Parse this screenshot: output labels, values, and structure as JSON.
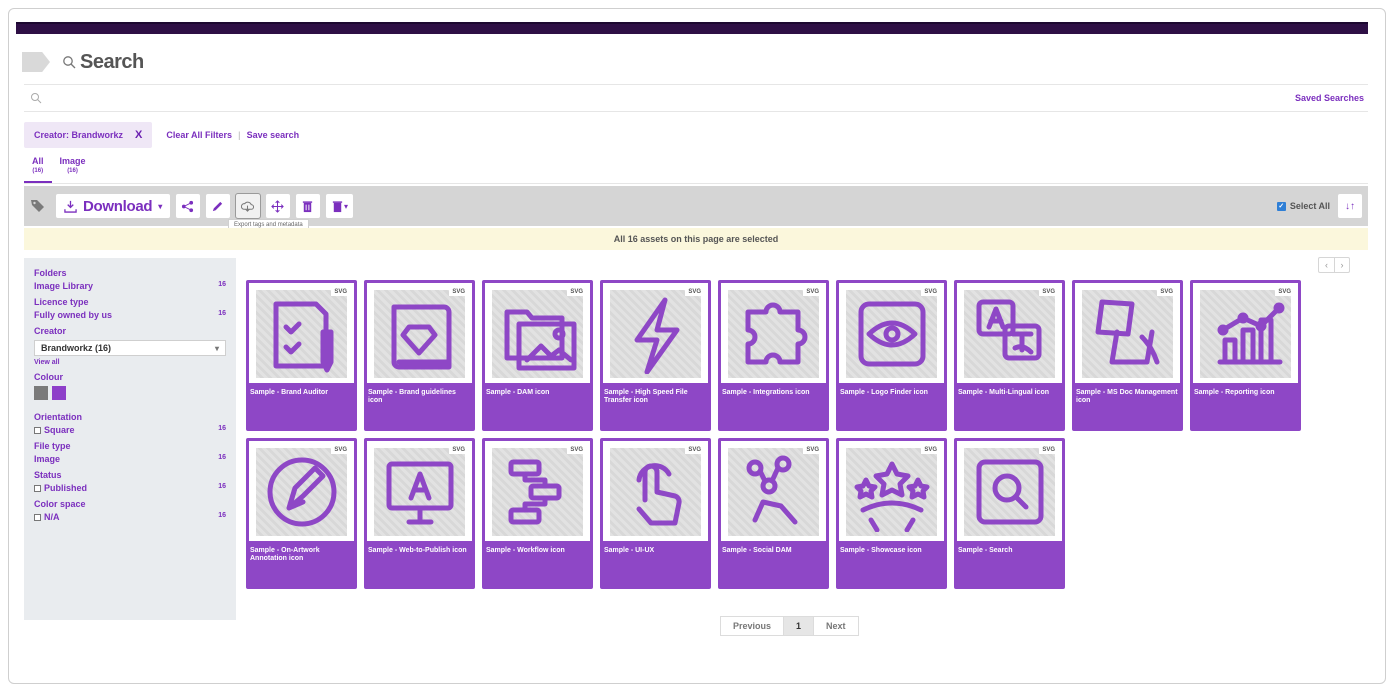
{
  "topnav": {
    "text": ""
  },
  "header": {
    "title": "Search"
  },
  "search": {
    "placeholder": "",
    "saved_searches": "Saved Searches"
  },
  "filters": {
    "chip_label": "Creator: Brandworkz",
    "chip_remove": "X",
    "clear_all": "Clear All Filters",
    "save_search": "Save search"
  },
  "tabs": [
    {
      "label": "All",
      "count": "(16)"
    },
    {
      "label": "Image",
      "count": "(16)"
    }
  ],
  "toolbar": {
    "download_label": "Download",
    "select_all": "Select All",
    "tooltip": "Export tags and metadata",
    "icons": [
      "tag-icon",
      "download-icon",
      "share-icon",
      "edit-icon",
      "export-metadata-icon",
      "move-icon",
      "delete-icon",
      "collection-icon",
      "sort-icon"
    ]
  },
  "notice": "All 16 assets on this page are selected",
  "sidebar": {
    "folders_head": "Folders",
    "folder_label": "Image Library",
    "folder_count": "16",
    "licence_head": "Licence type",
    "licence_label": "Fully owned by us",
    "licence_count": "16",
    "creator_head": "Creator",
    "creator_value": "Brandworkz (16)",
    "view_all": "View all",
    "colour_head": "Colour",
    "colours": [
      "#7a7a7a",
      "#8e3fc9"
    ],
    "orientation_head": "Orientation",
    "orientation_label": "Square",
    "orientation_count": "16",
    "filetype_head": "File type",
    "filetype_label": "Image",
    "filetype_count": "16",
    "status_head": "Status",
    "status_label": "Published",
    "status_count": "16",
    "colorspace_head": "Color space",
    "colorspace_label": "N/A",
    "colorspace_count": "16"
  },
  "assets": [
    {
      "caption": "Sample - Brand Auditor",
      "badge": "SVG",
      "icon": "clipboard-check-icon"
    },
    {
      "caption": "Sample - Brand guidelines icon",
      "badge": "SVG",
      "icon": "book-diamond-icon"
    },
    {
      "caption": "Sample - DAM icon",
      "badge": "SVG",
      "icon": "folders-image-icon"
    },
    {
      "caption": "Sample - High Speed File Transfer icon",
      "badge": "SVG",
      "icon": "lightning-icon"
    },
    {
      "caption": "Sample - Integrations icon",
      "badge": "SVG",
      "icon": "puzzle-icon"
    },
    {
      "caption": "Sample - Logo Finder icon",
      "badge": "SVG",
      "icon": "eye-icon"
    },
    {
      "caption": "Sample - Multi-Lingual icon",
      "badge": "SVG",
      "icon": "translate-icon"
    },
    {
      "caption": "Sample - MS Doc Management icon",
      "badge": "SVG",
      "icon": "document-hand-icon"
    },
    {
      "caption": "Sample - Reporting icon",
      "badge": "SVG",
      "icon": "chart-icon"
    },
    {
      "caption": "Sample - On-Artwork Annotation icon",
      "badge": "SVG",
      "icon": "pencil-circle-icon"
    },
    {
      "caption": "Sample - Web-to-Publish icon",
      "badge": "SVG",
      "icon": "monitor-a-icon"
    },
    {
      "caption": "Sample - Workflow icon",
      "badge": "SVG",
      "icon": "workflow-icon"
    },
    {
      "caption": "Sample - UI-UX",
      "badge": "SVG",
      "icon": "touch-icon"
    },
    {
      "caption": "Sample - Social DAM",
      "badge": "SVG",
      "icon": "social-hand-icon"
    },
    {
      "caption": "Sample - Showcase icon",
      "badge": "SVG",
      "icon": "stars-icon"
    },
    {
      "caption": "Sample - Search",
      "badge": "SVG",
      "icon": "search-box-icon"
    }
  ],
  "pagination": {
    "previous": "Previous",
    "current": "1",
    "next": "Next"
  }
}
